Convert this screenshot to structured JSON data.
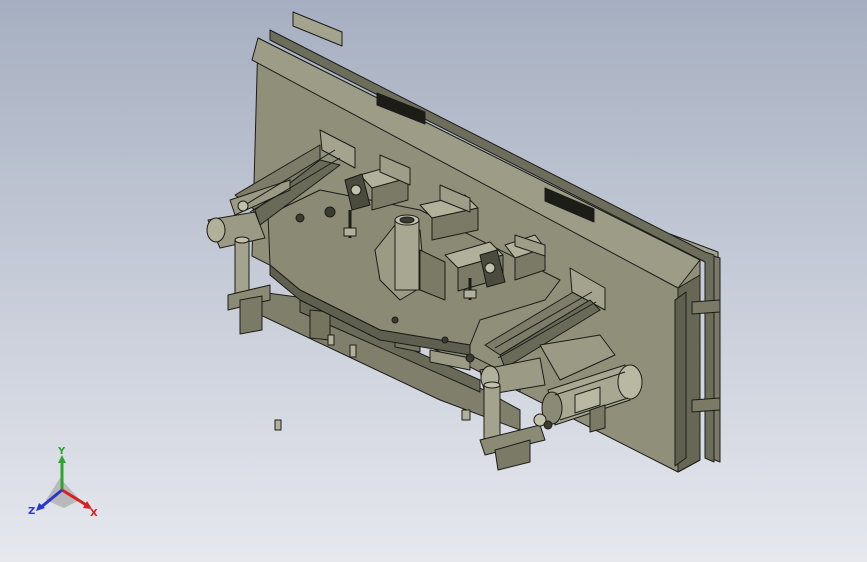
{
  "viewport": {
    "background_top": "#a6afc1",
    "background_bottom": "#e6e8ee",
    "model_color": "#8f8f7a",
    "model_dark": "#5f5f4f",
    "model_light": "#b4b4a0",
    "edge_color": "#1c1c18",
    "icon": "cad-3d-model"
  },
  "triad": {
    "y_label": "Y",
    "x_label": "X",
    "z_label": "Z",
    "y_color": "#2fa42f",
    "x_color": "#d92020",
    "z_color": "#2a35d0"
  }
}
